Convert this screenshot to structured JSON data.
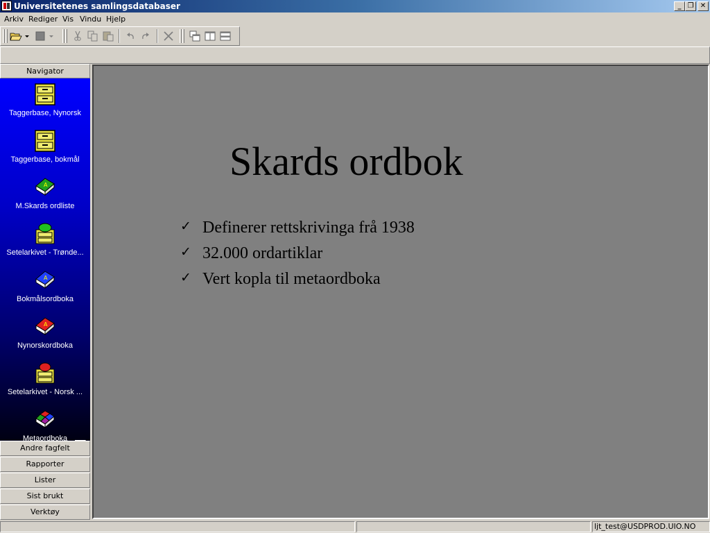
{
  "window": {
    "title": "Universitetenes samlingsdatabaser",
    "minimize_glyph": "_",
    "restore_glyph": "❐",
    "close_glyph": "✕"
  },
  "menu": {
    "items": [
      "Arkiv",
      "Rediger",
      "Vis",
      "Vindu",
      "Hjelp"
    ]
  },
  "toolbar": {
    "buttons": [
      "open-folder-icon",
      "dropdown-arrow-icon",
      "stop-icon",
      "dropdown-arrow-icon",
      "cut-icon",
      "copy-icon",
      "paste-icon",
      "undo-icon",
      "redo-icon",
      "delete-icon",
      "cascade-windows-icon",
      "tile-vertical-icon",
      "tile-horizontal-icon"
    ]
  },
  "sidebar": {
    "header": "Navigator",
    "items": [
      {
        "label": "Taggerbase, Nynorsk",
        "icon": "file-cabinet-icon"
      },
      {
        "label": "Taggerbase, bokmål",
        "icon": "file-cabinet-icon"
      },
      {
        "label": "M.Skards ordliste",
        "icon": "green-book-icon"
      },
      {
        "label": "Setelarkivet - Trønde...",
        "icon": "card-archive-green-icon"
      },
      {
        "label": "Bokmålsordboka",
        "icon": "blue-book-icon"
      },
      {
        "label": "Nynorskordboka",
        "icon": "red-book-icon"
      },
      {
        "label": "Setelarkivet - Norsk ...",
        "icon": "card-archive-red-icon"
      },
      {
        "label": "Metaordboka",
        "icon": "multicolor-book-icon"
      }
    ],
    "groups": [
      "Andre fagfelt",
      "Rapporter",
      "Lister",
      "Sist brukt",
      "Verktøy"
    ]
  },
  "slide": {
    "title": "Skards ordbok",
    "check_glyph": "✓",
    "bullets": [
      "Definerer rettskrivinga frå 1938",
      "32.000 ordartiklar",
      "Vert kopla til metaordboka"
    ]
  },
  "statusbar": {
    "pane1": "",
    "pane2": "",
    "user": "ljt_test@USDPROD.UIO.NO"
  },
  "colors": {
    "sidebar_gradient_top": "#0000ff",
    "sidebar_gradient_bottom": "#000012",
    "content_background": "#808080",
    "chrome": "#d4d0c8"
  }
}
